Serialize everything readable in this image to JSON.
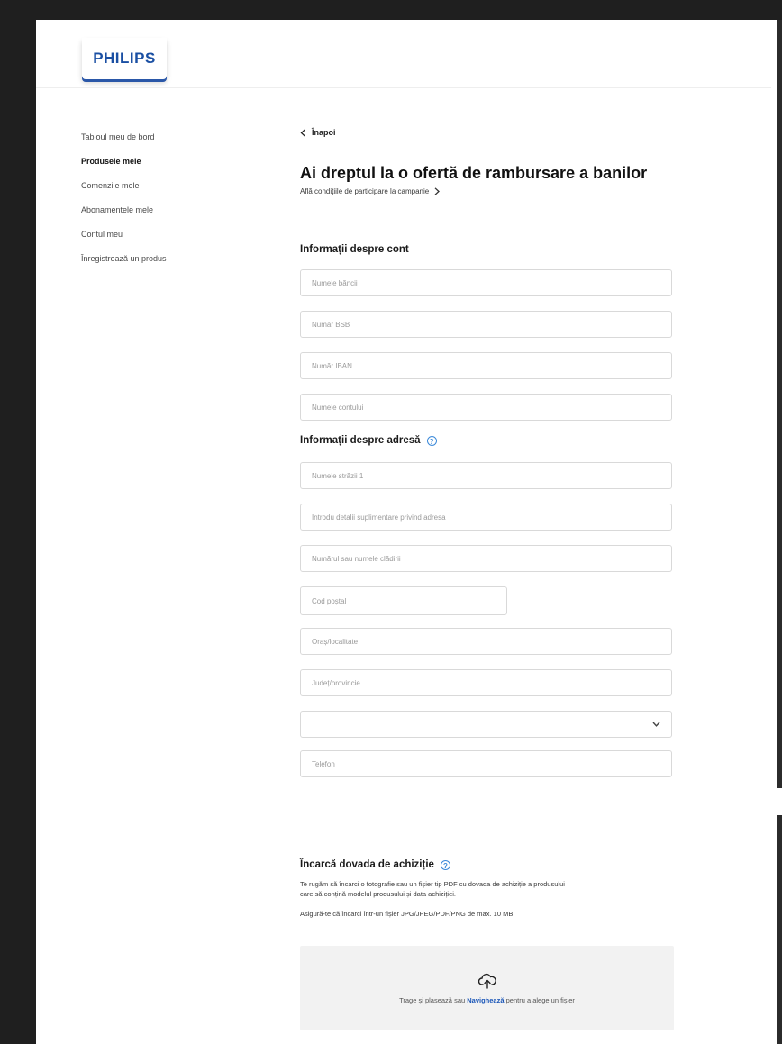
{
  "brand": {
    "logo_text": "PHILIPS"
  },
  "sidebar": {
    "items": [
      {
        "label": "Tabloul meu de bord",
        "active": false
      },
      {
        "label": "Produsele mele",
        "active": true
      },
      {
        "label": "Comenzile mele",
        "active": false
      },
      {
        "label": "Abonamentele mele",
        "active": false
      },
      {
        "label": "Contul meu",
        "active": false
      },
      {
        "label": "Înregistrează un produs",
        "active": false
      }
    ]
  },
  "main": {
    "back_label": "Înapoi",
    "title": "Ai dreptul la o ofertă de rambursare a banilor",
    "conditions_link": "Află condițiile de participare la campanie",
    "account_section": {
      "heading": "Informații despre cont",
      "fields": [
        {
          "placeholder": "Numele băncii",
          "value": ""
        },
        {
          "placeholder": "Număr BSB",
          "value": ""
        },
        {
          "placeholder": "Număr IBAN",
          "value": ""
        },
        {
          "placeholder": "Numele contului",
          "value": ""
        }
      ]
    },
    "address_section": {
      "heading": "Informații despre adresă",
      "fields": [
        {
          "placeholder": "Numele străzii 1",
          "value": ""
        },
        {
          "placeholder": "Introdu detalii suplimentare privind adresa",
          "value": ""
        },
        {
          "placeholder": "Numărul sau numele clădirii",
          "value": ""
        },
        {
          "placeholder": "Cod poștal",
          "value": ""
        },
        {
          "placeholder": "Oraș/localitate",
          "value": ""
        },
        {
          "placeholder": "Județ/provincie",
          "value": ""
        }
      ],
      "country_select": {
        "selected": ""
      },
      "phone": {
        "placeholder": "Telefon",
        "value": ""
      }
    },
    "upload_section": {
      "heading": "Încarcă dovada de achiziție",
      "description_1": "Te rugăm să încarci o fotografie sau un fișier tip PDF cu dovada de achiziție a produsului",
      "description_1b": "care să conțină modelul produsului și data achiziției.",
      "description_2": "Asigură-te că încarci într-un fișier JPG/JPEG/PDF/PNG de max. 10 MB.",
      "dropzone_before": "Trage și plasează sau ",
      "dropzone_browse": "Navighează",
      "dropzone_after": " pentru a alege un fișier"
    }
  },
  "colors": {
    "brand_blue": "#1a4fa3",
    "info_blue": "#3c8ad9",
    "link_blue": "#1a56b8",
    "border": "#d9d9d9",
    "dropzone_bg": "#f2f2f2"
  },
  "icons": {
    "back": "chevron-left-icon",
    "conditions": "chevron-right-icon",
    "info": "info-circle-icon",
    "select": "chevron-down-icon",
    "upload": "cloud-upload-icon"
  }
}
